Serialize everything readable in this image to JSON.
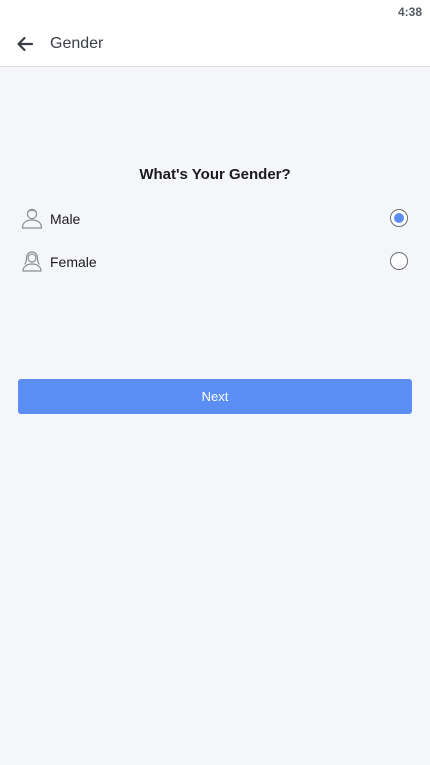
{
  "status_bar": {
    "time": "4:38"
  },
  "app_bar": {
    "title": "Gender",
    "back_icon": "arrow-left-icon"
  },
  "question": "What's Your Gender?",
  "options": [
    {
      "label": "Male",
      "icon": "male-user-icon",
      "selected": true
    },
    {
      "label": "Female",
      "icon": "female-user-icon",
      "selected": false
    }
  ],
  "next_button": {
    "label": "Next"
  },
  "colors": {
    "accent": "#5a8ef5",
    "radio_fill": "#5b8def",
    "background": "#f5f6f8"
  }
}
